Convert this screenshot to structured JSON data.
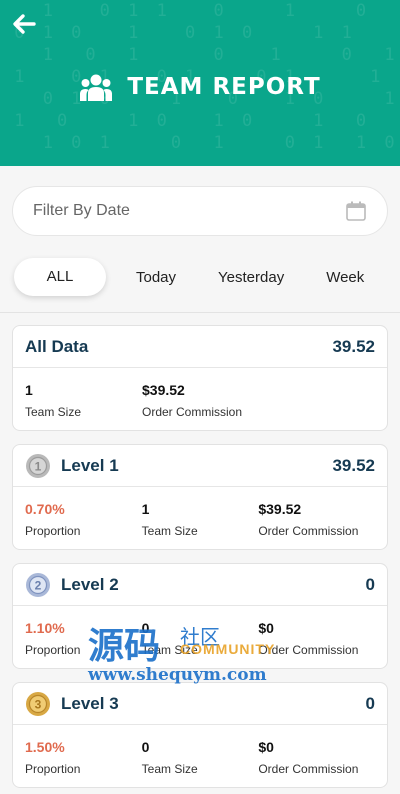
{
  "header": {
    "title": "TEAM REPORT",
    "bg_color": "#0aa68b",
    "back_icon": "arrow-left-icon",
    "title_icon": "team-users-icon"
  },
  "filter": {
    "placeholder": "Filter By Date",
    "icon": "calendar-icon"
  },
  "tabs": [
    {
      "label": "ALL",
      "active": true
    },
    {
      "label": "Today",
      "active": false
    },
    {
      "label": "Yesterday",
      "active": false
    },
    {
      "label": "Week",
      "active": false
    }
  ],
  "summary": {
    "title": "All Data",
    "total": "39.52",
    "stats": [
      {
        "value": "1",
        "label": "Team Size"
      },
      {
        "value": "$39.52",
        "label": "Order Commission"
      }
    ]
  },
  "levels": [
    {
      "title": "Level 1",
      "total": "39.52",
      "medal": "silver-medal-1-icon",
      "proportion": {
        "value": "0.70%",
        "label": "Proportion"
      },
      "team_size": {
        "value": "1",
        "label": "Team Size"
      },
      "commission": {
        "value": "$39.52",
        "label": "Order Commission"
      }
    },
    {
      "title": "Level 2",
      "total": "0",
      "medal": "blue-medal-2-icon",
      "proportion": {
        "value": "1.10%",
        "label": "Proportion"
      },
      "team_size": {
        "value": "0",
        "label": "Team Size"
      },
      "commission": {
        "value": "$0",
        "label": "Order Commission"
      }
    },
    {
      "title": "Level 3",
      "total": "0",
      "medal": "gold-medal-3-icon",
      "proportion": {
        "value": "1.50%",
        "label": "Proportion"
      },
      "team_size": {
        "value": "0",
        "label": "Team Size"
      },
      "commission": {
        "value": "$0",
        "label": "Order Commission"
      }
    }
  ],
  "watermark": {
    "big": "源码",
    "small": "社区",
    "community": "COMMUNITY",
    "url": "www.shequym.com"
  },
  "colors": {
    "accent": "#0aa68b",
    "title_text": "#163a52",
    "proportion": "#e06a4e"
  }
}
